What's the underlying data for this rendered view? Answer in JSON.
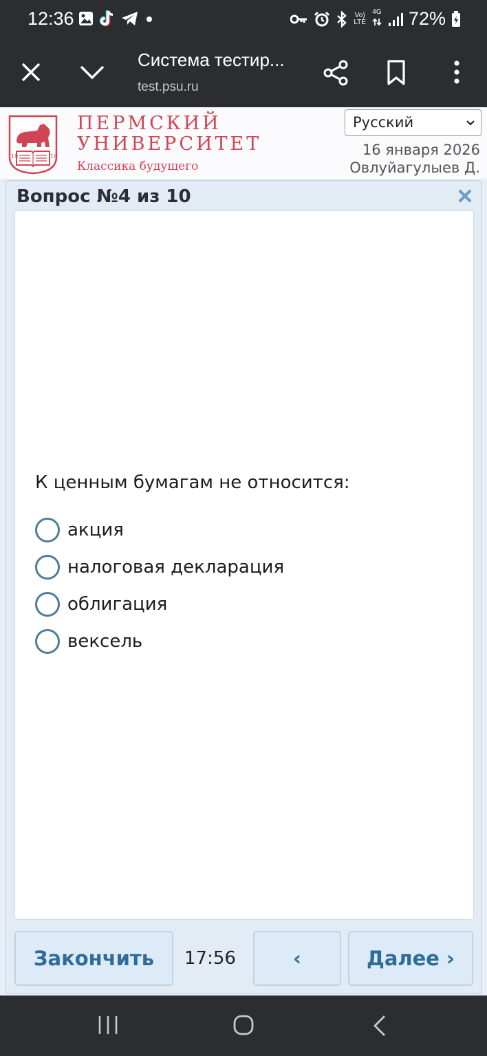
{
  "status_bar": {
    "time": "12:36",
    "battery": "72%",
    "volte_top": "Vo)",
    "volte_bottom": "LTE",
    "network": "4G",
    "icons": [
      "gallery-icon",
      "tiktok-icon",
      "telegram-icon",
      "dot-icon",
      "key-icon",
      "alarm-icon",
      "bluetooth-icon",
      "signal-icon",
      "battery-icon"
    ]
  },
  "browser": {
    "title": "Система тестир...",
    "url": "test.psu.ru",
    "icons": [
      "close-icon",
      "chevron-down-icon",
      "share-icon",
      "bookmark-icon",
      "more-vert-icon"
    ]
  },
  "header": {
    "logo_line1": "ПЕРМСКИЙ",
    "logo_line2": "УНИВЕРСИТЕТ",
    "slogan": "Классика будущего",
    "emblem_year_left": "19",
    "emblem_year_right": "16",
    "language": "Русский",
    "date": "16 января 2026",
    "user": "Овлуйагулыев Д."
  },
  "question": {
    "title": "Вопрос №4 из 10",
    "text": "К ценным бумагам не относится:",
    "options": [
      "акция",
      "налоговая декларация",
      "облигация",
      "вексель"
    ]
  },
  "footer": {
    "finish_label": "Закончить",
    "timer": "17:56",
    "prev_label": "‹",
    "next_label": "Далее ›"
  },
  "colors": {
    "brand_red": "#d04553",
    "accent_blue": "#2f6d98",
    "system_bar": "#2b2d31"
  }
}
